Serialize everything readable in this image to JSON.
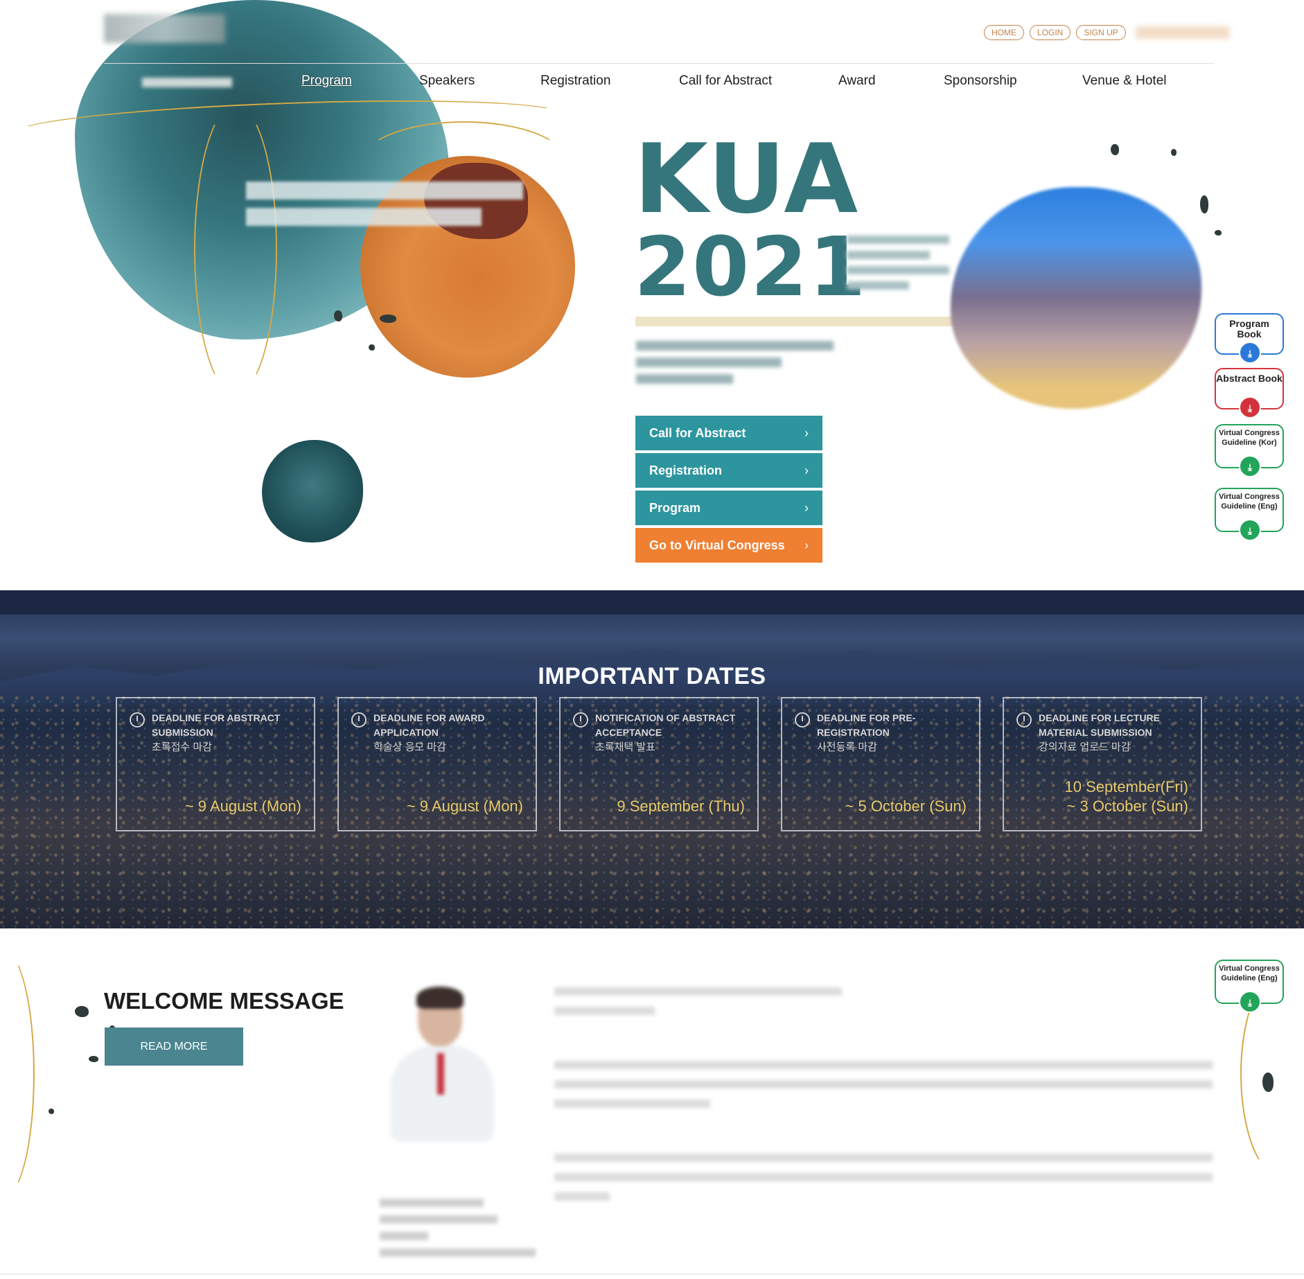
{
  "header": {
    "util_links": [
      "HOME",
      "LOGIN",
      "SIGN UP"
    ],
    "nav": [
      "Program",
      "Speakers",
      "Registration",
      "Call for Abstract",
      "Award",
      "Sponsorship",
      "Venue & Hotel"
    ],
    "active_nav": "Program"
  },
  "hero": {
    "title_line1": "KUA",
    "title_line2": "2021",
    "cta": [
      {
        "label": "Call for Abstract",
        "color": "#2d959e"
      },
      {
        "label": "Registration",
        "color": "#2d959e"
      },
      {
        "label": "Program",
        "color": "#2d959e"
      },
      {
        "label": "Go to Virtual Congress",
        "color": "#ef7f31"
      }
    ],
    "arrow_icon": "chevron-right-icon"
  },
  "side_downloads": [
    {
      "label": "Program Book",
      "color": "#2c78d8",
      "icon": "download-icon"
    },
    {
      "label": "Abstract Book",
      "color": "#d2333b",
      "icon": "download-icon"
    },
    {
      "label": "Virtual Congress Guideline (Kor)",
      "color": "#22a45a",
      "icon": "download-icon"
    },
    {
      "label": "Virtual Congress Guideline (Eng)",
      "color": "#22a45a",
      "icon": "download-icon"
    }
  ],
  "important_dates": {
    "title": "IMPORTANT DATES",
    "cards": [
      {
        "label": "DEADLINE FOR ABSTRACT SUBMISSION",
        "kor": "초록접수 마감",
        "value_line1": "~ 9 August (Mon)",
        "value_line2": ""
      },
      {
        "label": "DEADLINE FOR AWARD APPLICATION",
        "kor": "학술상 응모 마감",
        "value_line1": "~ 9 August (Mon)",
        "value_line2": ""
      },
      {
        "label": "NOTIFICATION OF ABSTRACT ACCEPTANCE",
        "kor": "초록채택 발표",
        "value_line1": "9 September (Thu)",
        "value_line2": ""
      },
      {
        "label": "DEADLINE FOR PRE-REGISTRATION",
        "kor": "사전등록 마감",
        "value_line1": "~ 5 October (Sun)",
        "value_line2": ""
      },
      {
        "label": "DEADLINE FOR LECTURE MATERIAL SUBMISSION",
        "kor": "강의자료 업로드 마감",
        "value_line1": "10 September(Fri)",
        "value_line2": "~ 3 October (Sun)"
      }
    ],
    "card_icon": "clock-icon"
  },
  "welcome": {
    "title": "WELCOME MESSAGE",
    "read_more": "READ MORE"
  },
  "colors": {
    "teal": "#2d959e",
    "orange": "#ef7f31",
    "gold": "#e8c96a",
    "kua_teal": "#35767c"
  }
}
